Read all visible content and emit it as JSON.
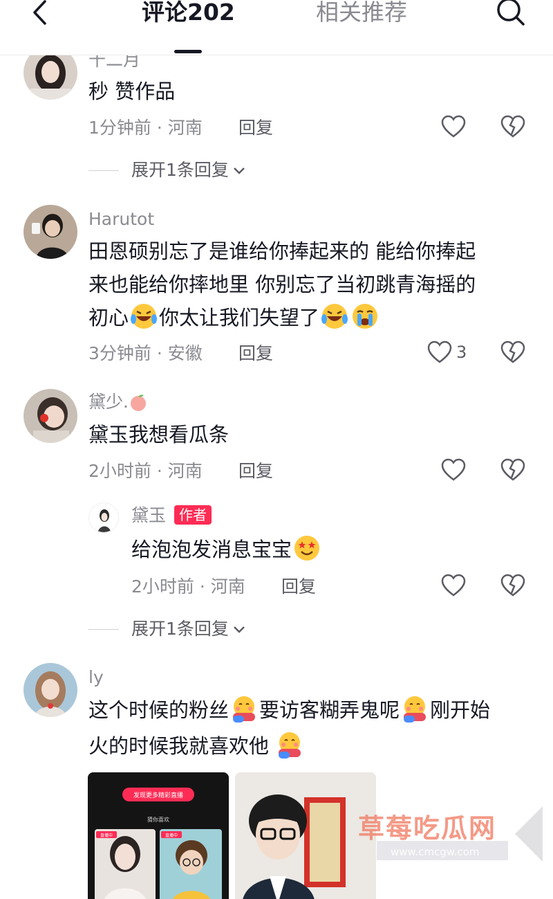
{
  "header": {
    "tab_comments": "评论202",
    "tab_related": "相关推荐"
  },
  "comments": [
    {
      "user": "十二月",
      "text": "秒 赞作品",
      "time": "1分钟前",
      "location": "河南",
      "reply_label": "回复",
      "expand_label": "展开1条回复"
    },
    {
      "user": "Harutot",
      "lines": [
        "田恩硕别忘了是谁给你捧起来的 能给你捧起",
        "来也能给你摔地里 你别忘了当初跳青海摇的",
        "初心",
        "你太让我们失望了"
      ],
      "time": "3分钟前",
      "location": "安徽",
      "reply_label": "回复",
      "likes": "3"
    },
    {
      "user": "黛少.",
      "text": "黛玉我想看瓜条",
      "time": "2小时前",
      "location": "河南",
      "reply_label": "回复",
      "reply": {
        "user": "黛玉",
        "badge": "作者",
        "text": "给泡泡发消息宝宝",
        "time": "2小时前",
        "location": "河南",
        "reply_label": "回复"
      },
      "expand_label": "展开1条回复"
    },
    {
      "user": "ly",
      "lines": [
        "这个时候的粉丝",
        "要访客糊弄鬼呢",
        "刚开始",
        "火的时候我就喜欢他"
      ]
    }
  ],
  "thumbnails": {
    "left_banner": "发现更多精彩直播",
    "left_sub": "猜你喜欢",
    "live_tag": "直播中"
  },
  "watermark": {
    "title": "草莓吃瓜网",
    "url": "www.cmcgw.com"
  },
  "colors": {
    "accent": "#fe2c55",
    "text": "#161823",
    "muted": "#8a8b91"
  }
}
